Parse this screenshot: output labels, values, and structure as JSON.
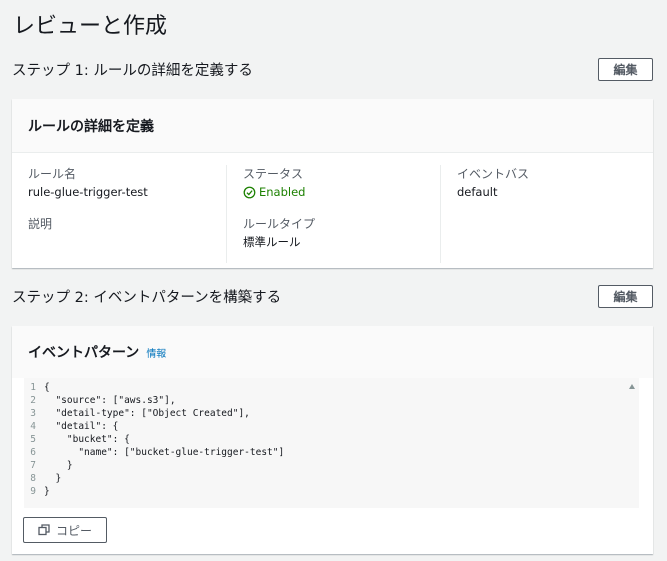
{
  "page": {
    "title": "レビューと作成"
  },
  "step1": {
    "title": "ステップ 1: ルールの詳細を定義する",
    "edit_label": "編集",
    "card_title": "ルールの詳細を定義",
    "fields": {
      "rule_name_label": "ルール名",
      "rule_name_value": "rule-glue-trigger-test",
      "description_label": "説明",
      "status_label": "ステータス",
      "status_value": "Enabled",
      "rule_type_label": "ルールタイプ",
      "rule_type_value": "標準ルール",
      "event_bus_label": "イベントバス",
      "event_bus_value": "default"
    }
  },
  "step2": {
    "title": "ステップ 2: イベントパターンを構築する",
    "edit_label": "編集",
    "card_title": "イベントパターン",
    "info_label": "情報",
    "code_lines": [
      {
        "n": "1",
        "text": "{"
      },
      {
        "n": "2",
        "text": "  \"source\": [\"aws.s3\"],"
      },
      {
        "n": "3",
        "text": "  \"detail-type\": [\"Object Created\"],"
      },
      {
        "n": "4",
        "text": "  \"detail\": {"
      },
      {
        "n": "5",
        "text": "    \"bucket\": {"
      },
      {
        "n": "6",
        "text": "      \"name\": [\"bucket-glue-trigger-test\"]"
      },
      {
        "n": "7",
        "text": "    }"
      },
      {
        "n": "8",
        "text": "  }"
      },
      {
        "n": "9",
        "text": "}"
      }
    ],
    "copy_label": "コピー"
  },
  "colors": {
    "status_green": "#1d8102",
    "link_blue": "#0073bb"
  },
  "icons": {
    "status": "check-circle-icon",
    "copy": "copy-icon"
  }
}
